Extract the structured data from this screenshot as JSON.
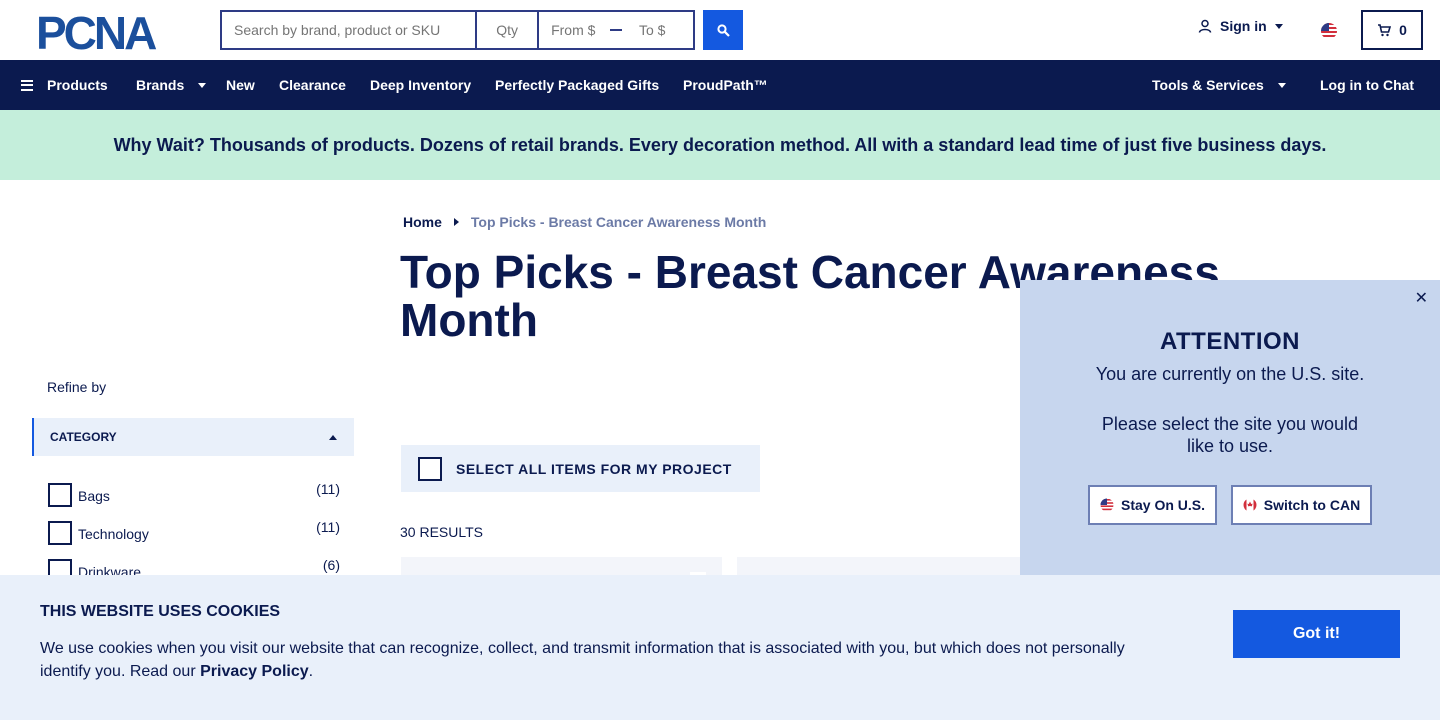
{
  "header": {
    "logo_text": "PCNA",
    "search": {
      "placeholder": "Search by brand, product or SKU",
      "qty_placeholder": "Qty",
      "from_placeholder": "From $",
      "to_placeholder": "To $"
    },
    "sign_in_label": "Sign in",
    "cart_count": "0"
  },
  "nav": {
    "products": "Products",
    "brands": "Brands",
    "new": "New",
    "clearance": "Clearance",
    "deep_inventory": "Deep Inventory",
    "gifts": "Perfectly Packaged Gifts",
    "proudpath": "ProudPath™",
    "tools": "Tools & Services",
    "chat": "Log in to Chat"
  },
  "promo": "Why Wait? Thousands of products. Dozens of retail brands. Every decoration method. All with a standard lead time of just five business days.",
  "breadcrumb": {
    "home": "Home",
    "current": "Top Picks - Breast Cancer Awareness Month"
  },
  "page_title": "Top Picks - Breast Cancer Awareness Month",
  "sidebar": {
    "refine_label": "Refine by",
    "category_label": "CATEGORY",
    "categories": [
      {
        "label": "Bags",
        "count": "(11)"
      },
      {
        "label": "Technology",
        "count": "(11)"
      },
      {
        "label": "Drinkware",
        "count": "(6)"
      }
    ]
  },
  "select_all_label": "SELECT ALL ITEMS FOR MY PROJECT",
  "results_label": "30 RESULTS",
  "attention": {
    "title": "ATTENTION",
    "line1": "You are currently on the U.S. site.",
    "line2": "Please select the site you would like to use.",
    "stay_label": "Stay On U.S.",
    "switch_label": "Switch to CAN"
  },
  "cookie": {
    "title": "THIS WEBSITE USES COOKIES",
    "text": "We use cookies when you visit our website that can recognize, collect, and transmit information that is associated with you, but which does not personally identify you. Read our",
    "link": "Privacy Policy",
    "period": ".",
    "button": "Got it!"
  },
  "colors": {
    "navy": "#0b1a4f",
    "blue": "#1459e0",
    "promo_bg": "#c4eedb",
    "panel_bg": "#c7d6ee",
    "cookie_bg": "#e9f0fa"
  }
}
